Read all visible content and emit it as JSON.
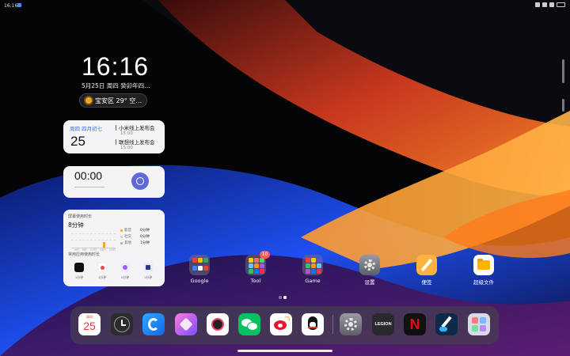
{
  "status_bar": {
    "time": "16:16"
  },
  "lock_clock": {
    "time": "16:16",
    "date": "5月25日 周四 癸卯年四…"
  },
  "weather": {
    "text": "宝安区 29° 空…"
  },
  "calendar_widget": {
    "header": "周四  四月初七",
    "day": "25",
    "events": [
      {
        "title": "小米线上发布会",
        "time": "15:00"
      },
      {
        "title": "联想线上发布会",
        "time": "15:00"
      }
    ]
  },
  "timer_widget": {
    "value": "00:00"
  },
  "usage_widget": {
    "title": "屏幕使用时长",
    "total": "8分钟",
    "chart_ticks": [
      "0时",
      "6时",
      "12时",
      "18时",
      "24时"
    ],
    "legend": [
      {
        "name": "影音",
        "value": "0分钟",
        "color": "#f5a623"
      },
      {
        "name": "社交",
        "value": "0分钟",
        "color": "#d0d0d0"
      },
      {
        "name": "其他",
        "value": "1分钟",
        "color": "#b0b0b0"
      }
    ],
    "subtitle": "常用应用使用时长",
    "apps": [
      {
        "time": "1分钟",
        "color": "#111111"
      },
      {
        "time": "1分钟",
        "color": "#ee4444"
      },
      {
        "time": "0分钟",
        "color": "#a15cff"
      },
      {
        "time": "1分钟",
        "color": "#2d3a8c"
      }
    ]
  },
  "home_apps": [
    {
      "label": "Google",
      "kind": "folder"
    },
    {
      "label": "Tool",
      "kind": "folder",
      "badge": "10"
    },
    {
      "label": "Game",
      "kind": "folder"
    },
    {
      "label": "设置",
      "icon": "gear-icon"
    },
    {
      "label": "便签",
      "icon": "pencil-icon"
    },
    {
      "label": "超级文件",
      "icon": "folder-icon"
    }
  ],
  "dock": {
    "calendar": {
      "weekday": "周四",
      "day": "25"
    },
    "apps": [
      "calendar-icon",
      "clock-icon",
      "browser-icon",
      "gallery-icon",
      "camera-icon",
      "wechat-icon",
      "weibo-icon",
      "qq-icon",
      "settings-icon",
      "legion-icon",
      "netflix-icon",
      "paint-icon",
      "app-library-icon"
    ],
    "legion_text": "LEGION",
    "netflix_text": "N"
  },
  "colors": {
    "accent_blue": "#3b6cf5",
    "timer_button": "#5f6ad8",
    "badge_red": "#ff5a5a"
  }
}
